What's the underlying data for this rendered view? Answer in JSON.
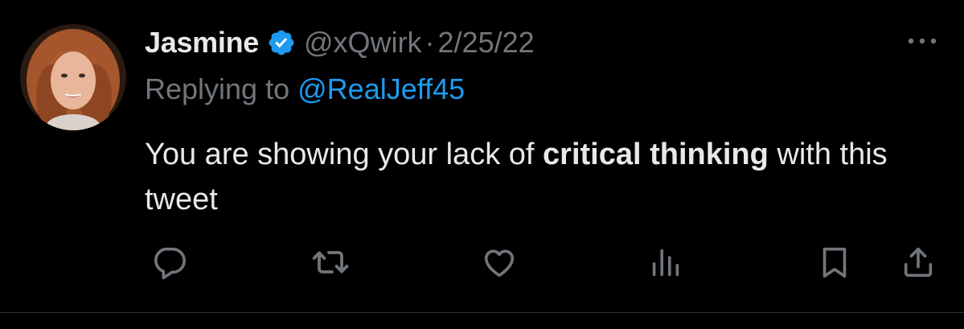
{
  "tweet": {
    "author": {
      "display_name": "Jasmine",
      "handle": "@xQwirk",
      "verified": true,
      "avatar": "profile-photo"
    },
    "separator": "·",
    "date": "2/25/22",
    "reply": {
      "prefix": "Replying to",
      "target": "@RealJeff45"
    },
    "text": {
      "part1": "You are showing your lack of ",
      "bold": "critical thinking",
      "part2": " with this tweet"
    },
    "actions": [
      {
        "icon": "reply-icon"
      },
      {
        "icon": "retweet-icon"
      },
      {
        "icon": "like-icon"
      },
      {
        "icon": "views-icon"
      },
      {
        "icon": "bookmark-icon"
      },
      {
        "icon": "share-icon"
      }
    ],
    "more_icon": "more-options-icon"
  },
  "colors": {
    "background": "#000000",
    "text": "#e7e9ea",
    "secondary": "#71767b",
    "accent": "#1d9bf0",
    "divider": "#2f3336"
  }
}
